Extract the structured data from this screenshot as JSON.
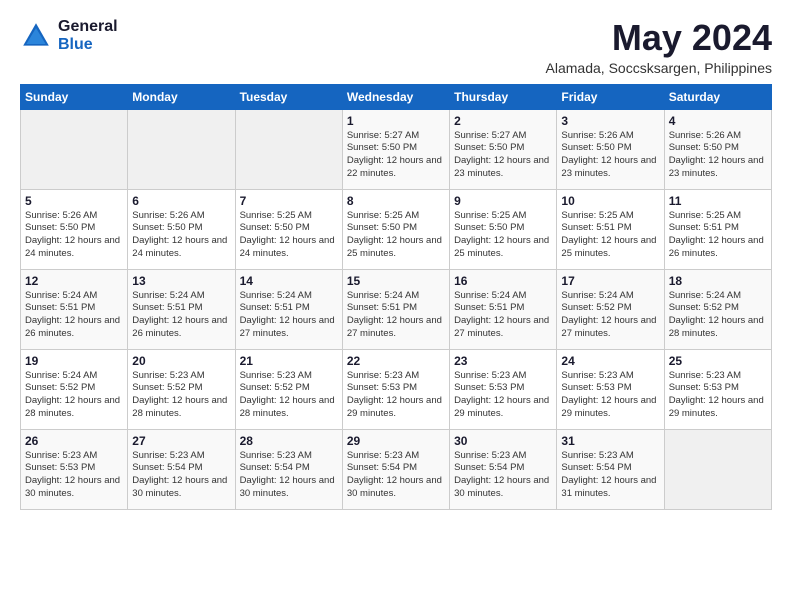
{
  "header": {
    "logo_general": "General",
    "logo_blue": "Blue",
    "month_title": "May 2024",
    "subtitle": "Alamada, Soccsksargen, Philippines"
  },
  "days_of_week": [
    "Sunday",
    "Monday",
    "Tuesday",
    "Wednesday",
    "Thursday",
    "Friday",
    "Saturday"
  ],
  "weeks": [
    [
      {
        "day": "",
        "info": ""
      },
      {
        "day": "",
        "info": ""
      },
      {
        "day": "",
        "info": ""
      },
      {
        "day": "1",
        "info": "Sunrise: 5:27 AM\nSunset: 5:50 PM\nDaylight: 12 hours\nand 22 minutes."
      },
      {
        "day": "2",
        "info": "Sunrise: 5:27 AM\nSunset: 5:50 PM\nDaylight: 12 hours\nand 23 minutes."
      },
      {
        "day": "3",
        "info": "Sunrise: 5:26 AM\nSunset: 5:50 PM\nDaylight: 12 hours\nand 23 minutes."
      },
      {
        "day": "4",
        "info": "Sunrise: 5:26 AM\nSunset: 5:50 PM\nDaylight: 12 hours\nand 23 minutes."
      }
    ],
    [
      {
        "day": "5",
        "info": "Sunrise: 5:26 AM\nSunset: 5:50 PM\nDaylight: 12 hours\nand 24 minutes."
      },
      {
        "day": "6",
        "info": "Sunrise: 5:26 AM\nSunset: 5:50 PM\nDaylight: 12 hours\nand 24 minutes."
      },
      {
        "day": "7",
        "info": "Sunrise: 5:25 AM\nSunset: 5:50 PM\nDaylight: 12 hours\nand 24 minutes."
      },
      {
        "day": "8",
        "info": "Sunrise: 5:25 AM\nSunset: 5:50 PM\nDaylight: 12 hours\nand 25 minutes."
      },
      {
        "day": "9",
        "info": "Sunrise: 5:25 AM\nSunset: 5:50 PM\nDaylight: 12 hours\nand 25 minutes."
      },
      {
        "day": "10",
        "info": "Sunrise: 5:25 AM\nSunset: 5:51 PM\nDaylight: 12 hours\nand 25 minutes."
      },
      {
        "day": "11",
        "info": "Sunrise: 5:25 AM\nSunset: 5:51 PM\nDaylight: 12 hours\nand 26 minutes."
      }
    ],
    [
      {
        "day": "12",
        "info": "Sunrise: 5:24 AM\nSunset: 5:51 PM\nDaylight: 12 hours\nand 26 minutes."
      },
      {
        "day": "13",
        "info": "Sunrise: 5:24 AM\nSunset: 5:51 PM\nDaylight: 12 hours\nand 26 minutes."
      },
      {
        "day": "14",
        "info": "Sunrise: 5:24 AM\nSunset: 5:51 PM\nDaylight: 12 hours\nand 27 minutes."
      },
      {
        "day": "15",
        "info": "Sunrise: 5:24 AM\nSunset: 5:51 PM\nDaylight: 12 hours\nand 27 minutes."
      },
      {
        "day": "16",
        "info": "Sunrise: 5:24 AM\nSunset: 5:51 PM\nDaylight: 12 hours\nand 27 minutes."
      },
      {
        "day": "17",
        "info": "Sunrise: 5:24 AM\nSunset: 5:52 PM\nDaylight: 12 hours\nand 27 minutes."
      },
      {
        "day": "18",
        "info": "Sunrise: 5:24 AM\nSunset: 5:52 PM\nDaylight: 12 hours\nand 28 minutes."
      }
    ],
    [
      {
        "day": "19",
        "info": "Sunrise: 5:24 AM\nSunset: 5:52 PM\nDaylight: 12 hours\nand 28 minutes."
      },
      {
        "day": "20",
        "info": "Sunrise: 5:23 AM\nSunset: 5:52 PM\nDaylight: 12 hours\nand 28 minutes."
      },
      {
        "day": "21",
        "info": "Sunrise: 5:23 AM\nSunset: 5:52 PM\nDaylight: 12 hours\nand 28 minutes."
      },
      {
        "day": "22",
        "info": "Sunrise: 5:23 AM\nSunset: 5:53 PM\nDaylight: 12 hours\nand 29 minutes."
      },
      {
        "day": "23",
        "info": "Sunrise: 5:23 AM\nSunset: 5:53 PM\nDaylight: 12 hours\nand 29 minutes."
      },
      {
        "day": "24",
        "info": "Sunrise: 5:23 AM\nSunset: 5:53 PM\nDaylight: 12 hours\nand 29 minutes."
      },
      {
        "day": "25",
        "info": "Sunrise: 5:23 AM\nSunset: 5:53 PM\nDaylight: 12 hours\nand 29 minutes."
      }
    ],
    [
      {
        "day": "26",
        "info": "Sunrise: 5:23 AM\nSunset: 5:53 PM\nDaylight: 12 hours\nand 30 minutes."
      },
      {
        "day": "27",
        "info": "Sunrise: 5:23 AM\nSunset: 5:54 PM\nDaylight: 12 hours\nand 30 minutes."
      },
      {
        "day": "28",
        "info": "Sunrise: 5:23 AM\nSunset: 5:54 PM\nDaylight: 12 hours\nand 30 minutes."
      },
      {
        "day": "29",
        "info": "Sunrise: 5:23 AM\nSunset: 5:54 PM\nDaylight: 12 hours\nand 30 minutes."
      },
      {
        "day": "30",
        "info": "Sunrise: 5:23 AM\nSunset: 5:54 PM\nDaylight: 12 hours\nand 30 minutes."
      },
      {
        "day": "31",
        "info": "Sunrise: 5:23 AM\nSunset: 5:54 PM\nDaylight: 12 hours\nand 31 minutes."
      },
      {
        "day": "",
        "info": ""
      }
    ]
  ]
}
